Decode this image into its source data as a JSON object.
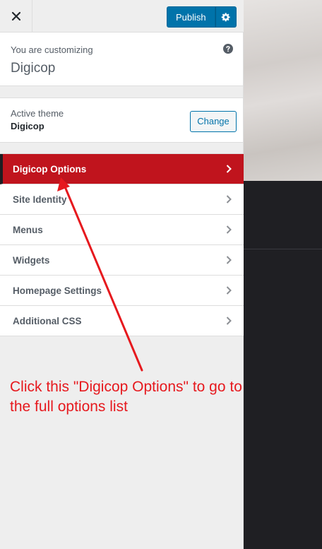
{
  "header": {
    "close_icon": "close-icon",
    "publish_label": "Publish",
    "settings_icon": "gear-icon"
  },
  "info": {
    "customizing_label": "You are customizing",
    "site_title": "Digicop",
    "help_icon": "help-icon"
  },
  "theme": {
    "active_label": "Active theme",
    "name": "Digicop",
    "change_label": "Change"
  },
  "menu": {
    "items": [
      {
        "label": "Digicop Options",
        "active": true
      },
      {
        "label": "Site Identity"
      },
      {
        "label": "Menus"
      },
      {
        "label": "Widgets"
      },
      {
        "label": "Homepage Settings"
      },
      {
        "label": "Additional CSS"
      }
    ]
  },
  "annotation": {
    "text": "Click this \"Digicop Options\" to go to the full options list"
  },
  "colors": {
    "accent": "#0073aa",
    "active_item": "#c0141d",
    "annotation": "#e6191e"
  }
}
